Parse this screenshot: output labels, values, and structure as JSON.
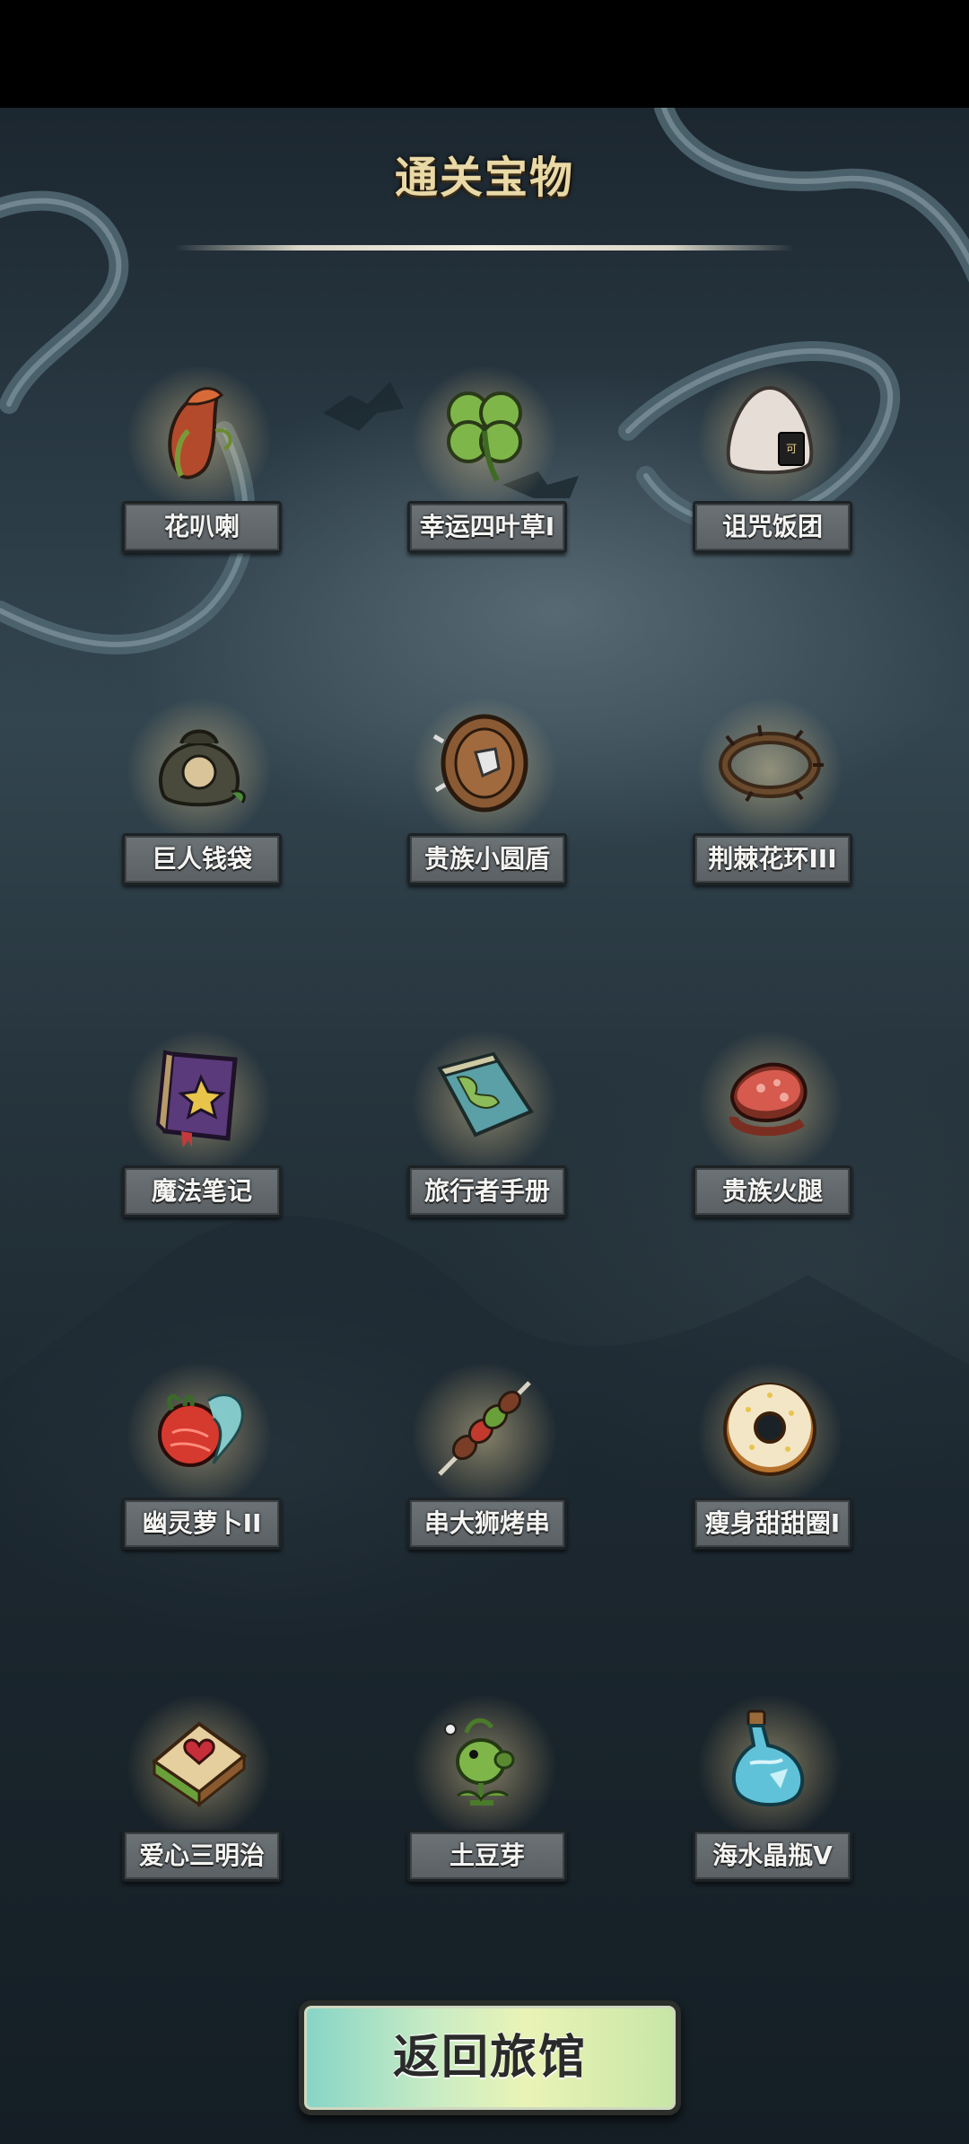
{
  "title": "通关宝物",
  "items": [
    {
      "label": "花叭喇",
      "icon": "pitcher-plant-icon"
    },
    {
      "label": "幸运四叶草I",
      "icon": "four-leaf-clover-icon"
    },
    {
      "label": "诅咒饭团",
      "icon": "rice-ball-icon"
    },
    {
      "label": "巨人钱袋",
      "icon": "money-bag-icon"
    },
    {
      "label": "贵族小圆盾",
      "icon": "round-shield-icon"
    },
    {
      "label": "荆棘花环III",
      "icon": "thorn-wreath-icon"
    },
    {
      "label": "魔法笔记",
      "icon": "magic-book-icon"
    },
    {
      "label": "旅行者手册",
      "icon": "map-icon"
    },
    {
      "label": "贵族火腿",
      "icon": "ham-icon"
    },
    {
      "label": "幽灵萝卜II",
      "icon": "ghost-radish-icon"
    },
    {
      "label": "串大狮烤串",
      "icon": "kebab-icon"
    },
    {
      "label": "瘦身甜甜圈I",
      "icon": "donut-icon"
    },
    {
      "label": "爱心三明治",
      "icon": "sandwich-icon"
    },
    {
      "label": "土豆芽",
      "icon": "sprout-plant-icon"
    },
    {
      "label": "海水晶瓶V",
      "icon": "potion-bottle-icon"
    }
  ],
  "return_button": "返回旅馆"
}
